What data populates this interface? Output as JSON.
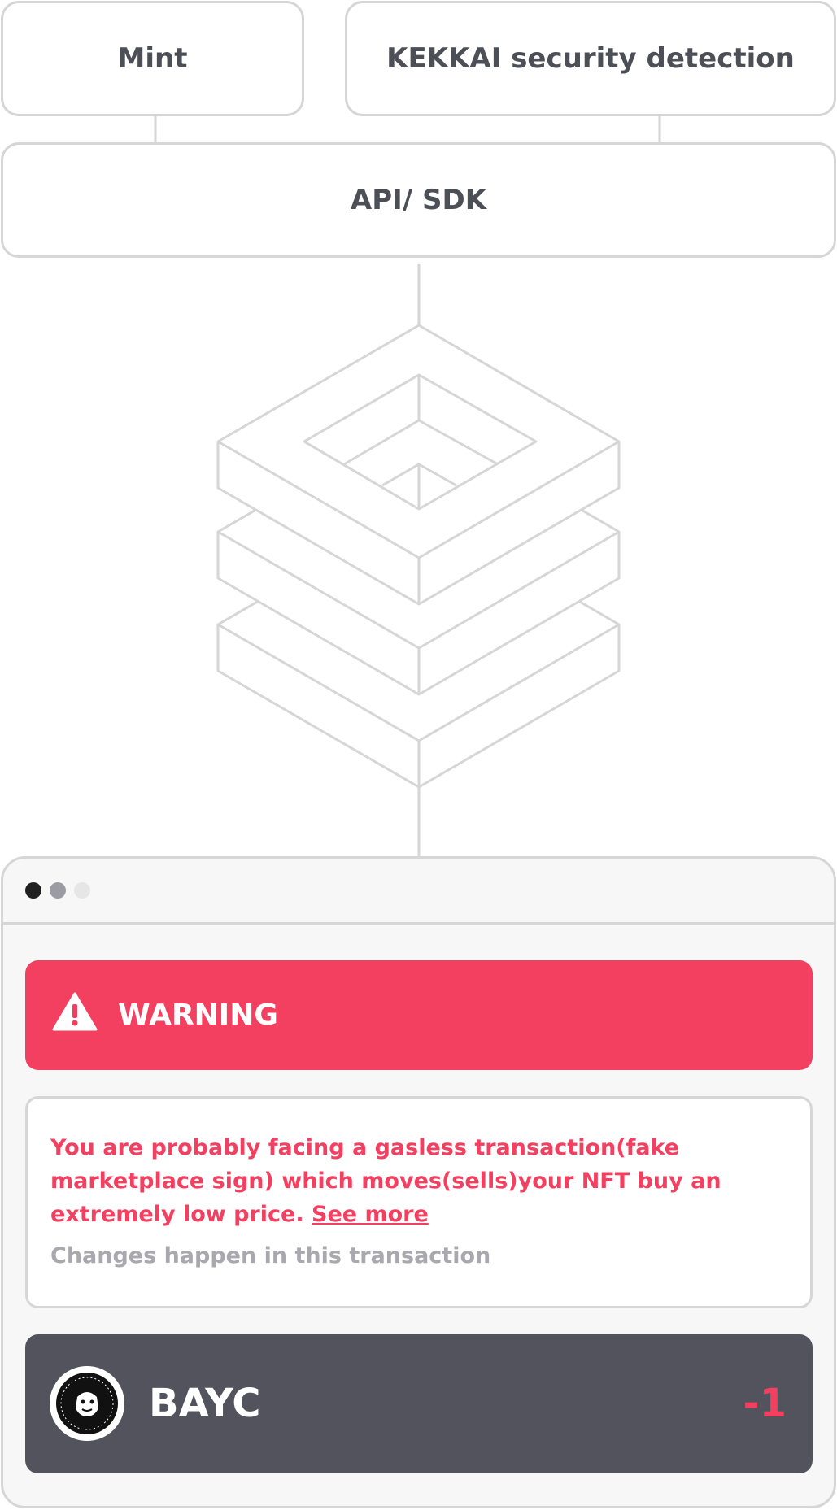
{
  "top_nodes": {
    "mint_label": "Mint",
    "kekkai_label": "KEKKAI security detection",
    "api_label": "API/ SDK"
  },
  "core_icon": "stacked-layers-icon",
  "window": {
    "warning_label": "WARNING",
    "message_text": "You are probably facing a gasless transaction(fake marketplace sign) which moves(sells)your NFT buy an extremely low price.",
    "see_more_label": "See more",
    "changes_label": "Changes happen in this transaction",
    "nft": {
      "name": "BAYC",
      "amount": "-1",
      "avatar_icon": "bored-ape-yacht-club-logo"
    }
  },
  "colors": {
    "warning": "#f34060",
    "border": "#d6d6d6",
    "nft_row": "#53535e",
    "text": "#4d4f57"
  }
}
